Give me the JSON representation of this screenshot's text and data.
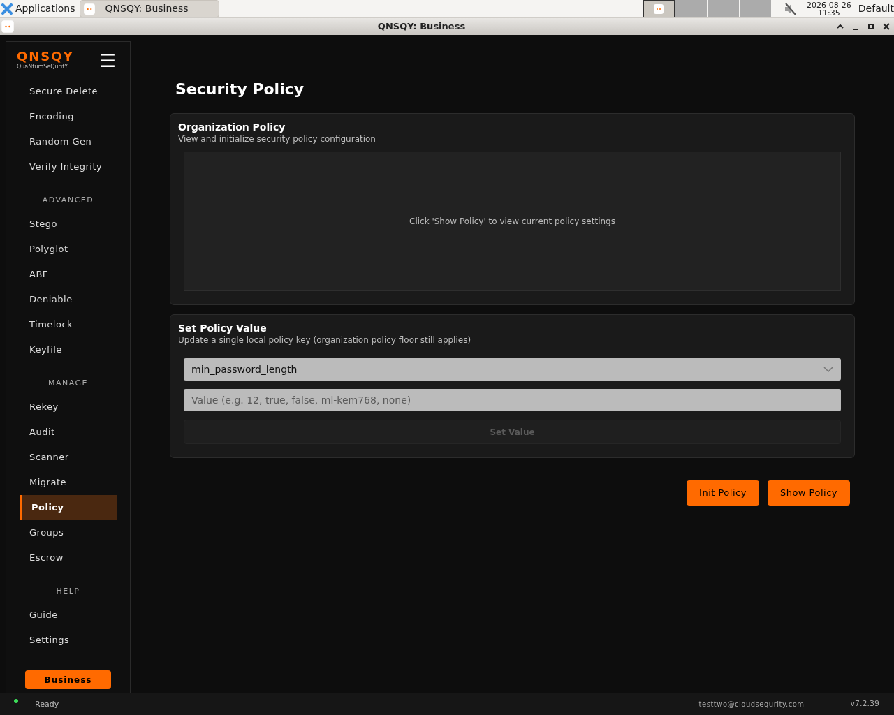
{
  "taskbar": {
    "menu": "Applications",
    "tasks": [
      {
        "label": "QNSQY: Business",
        "selected": true
      }
    ],
    "workspaces": [
      {
        "selected": true
      },
      {
        "selected": false
      },
      {
        "selected": false
      },
      {
        "selected": false
      }
    ],
    "muted": true,
    "date": "2026-08-26",
    "time": "11:35",
    "layout": "Default"
  },
  "window": {
    "title": "QNSQY: Business"
  },
  "sidebar": {
    "logo": "QNSQY",
    "tagline": "QuaNtumSeQuritY",
    "menu_icon": "☰",
    "groups": [
      {
        "items": [
          {
            "label": "Secure Delete",
            "selected": false
          },
          {
            "label": "Encoding",
            "selected": false
          },
          {
            "label": "Random Gen",
            "selected": false
          },
          {
            "label": "Verify Integrity",
            "selected": false
          }
        ]
      },
      {
        "heading": "ADVANCED",
        "items": [
          {
            "label": "Stego",
            "selected": false
          },
          {
            "label": "Polyglot",
            "selected": false
          },
          {
            "label": "ABE",
            "selected": false
          },
          {
            "label": "Deniable",
            "selected": false
          },
          {
            "label": "Timelock",
            "selected": false
          },
          {
            "label": "Keyfile",
            "selected": false
          }
        ]
      },
      {
        "heading": "MANAGE",
        "items": [
          {
            "label": "Rekey",
            "selected": false
          },
          {
            "label": "Audit",
            "selected": false
          },
          {
            "label": "Scanner",
            "selected": false
          },
          {
            "label": "Migrate",
            "selected": false
          },
          {
            "label": "Policy",
            "selected": true
          },
          {
            "label": "Groups",
            "selected": false
          },
          {
            "label": "Escrow",
            "selected": false
          }
        ]
      },
      {
        "heading": "HELP",
        "items": [
          {
            "label": "Guide",
            "selected": false
          },
          {
            "label": "Settings",
            "selected": false
          }
        ]
      }
    ],
    "tier_button": "Business"
  },
  "page": {
    "title": "Security Policy",
    "organization_policy": {
      "title": "Organization Policy",
      "subtitle": "View and initialize security policy configuration",
      "empty_message": "Click 'Show Policy' to view current policy settings"
    },
    "set_policy_value": {
      "title": "Set Policy Value",
      "subtitle": "Update a single local policy key (organization policy floor still applies)",
      "key_select": "min_password_length",
      "value_field": {
        "placeholder": "Value (e.g. 12, true, false, ml-kem768, none)"
      },
      "submit": {
        "label": "Set Value",
        "disabled": true
      }
    },
    "actions": [
      "Init Policy",
      "Show Policy"
    ]
  },
  "status_bar": {
    "status": "Ready",
    "online": true,
    "user": "testtwo@cloudsequrity.com",
    "version": "v7.2.39"
  }
}
